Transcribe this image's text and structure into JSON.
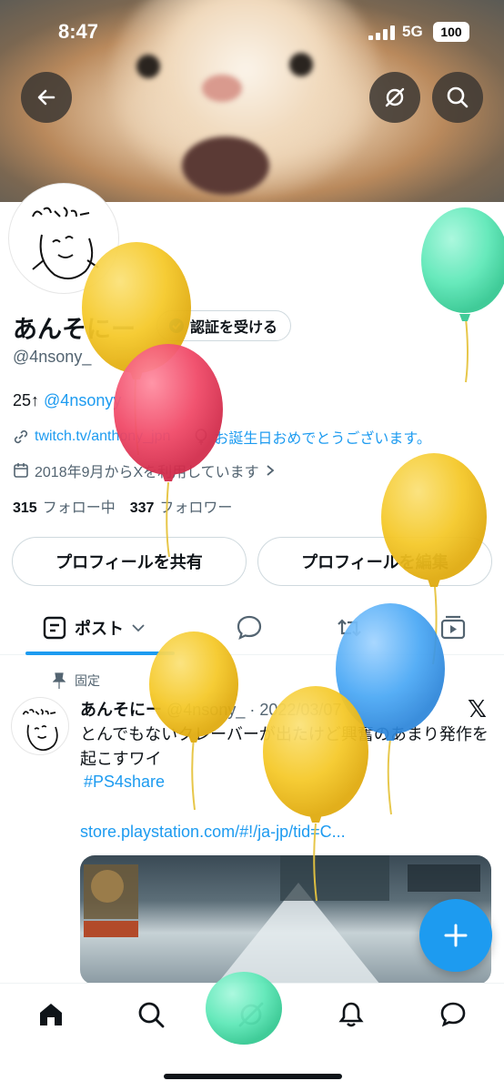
{
  "status_bar": {
    "time": "8:47",
    "network": "5G",
    "battery": "100"
  },
  "profile": {
    "name": "あんそにー",
    "verify_label": "認証を受ける",
    "handle": "@4nsony_",
    "bio_prefix": "25↑ ",
    "bio_link": "@4nsonyy",
    "website": "twitch.tv/anthony_jpn",
    "birthday": "お誕生日おめでとうございます。",
    "joined": "2018年9月からXを利用しています",
    "following_count": "315",
    "following_label": "フォロー中",
    "followers_count": "337",
    "followers_label": "フォロワー",
    "share_button": "プロフィールを共有",
    "edit_button": "プロフィールを編集"
  },
  "tabs": {
    "posts_label": "ポスト"
  },
  "post": {
    "pinned_label": "固定",
    "author": "あんそにー",
    "meta": "@4nsony_ · 2022/03/07",
    "text": "とんでもないクレーバーが出たけど興奮のあまり発作を起こすワイ",
    "hashtag": "#PS4share",
    "url": "store.playstation.com/#!/ja-jp/tid=C..."
  },
  "icons": {
    "back": "back-arrow-icon",
    "grok": "grok-icon",
    "search": "search-icon",
    "pin": "pin-icon",
    "x_logo": "x-logo-icon",
    "fab": "plus-icon"
  },
  "colors": {
    "accent": "#1d9bf0",
    "balloon_yellow": "#f7cd2e",
    "balloon_pink": "#f0506e",
    "balloon_green": "#5fe8b8",
    "balloon_blue": "#4aa8f5"
  }
}
